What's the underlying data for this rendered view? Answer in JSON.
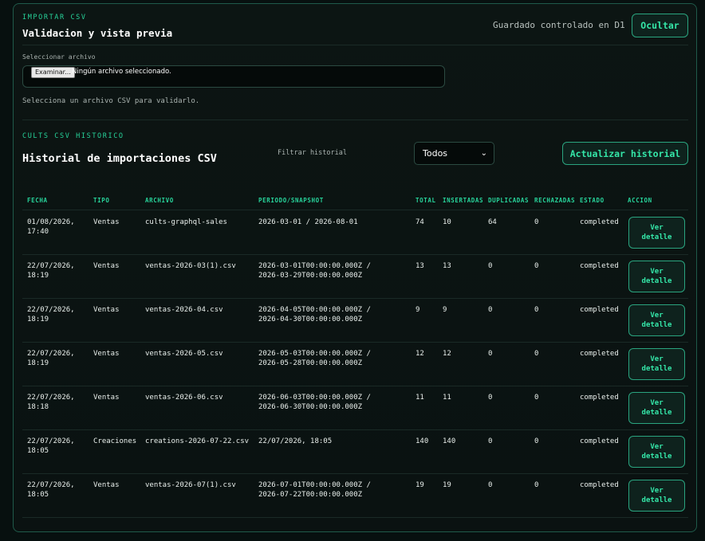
{
  "import": {
    "eyebrow": "IMPORTAR CSV",
    "title": "Validacion y vista previa",
    "saved_status": "Guardado controlado en D1",
    "hide_label": "Ocultar",
    "file_label": "Seleccionar archivo",
    "file_button": "Examinar...",
    "file_status": "Ningún archivo seleccionado.",
    "hint": "Selecciona un archivo CSV para validarlo."
  },
  "history": {
    "eyebrow": "CULTS CSV HISTORICO",
    "title": "Historial de importaciones CSV",
    "filter_label": "Filtrar historial",
    "filter_value": "Todos",
    "refresh_label": "Actualizar historial",
    "columns": [
      "FECHA",
      "TIPO",
      "ARCHIVO",
      "PERIODO/SNAPSHOT",
      "TOTAL",
      "INSERTADAS",
      "DUPLICADAS",
      "RECHAZADAS",
      "ESTADO",
      "ACCION"
    ],
    "rows": [
      {
        "fecha": "01/08/2026,\n17:40",
        "tipo": "Ventas",
        "archivo": "cults-graphql-sales",
        "periodo": "2026-03-01 / 2026-08-01",
        "total": "74",
        "insertadas": "10",
        "duplicadas": "64",
        "rechazadas": "0",
        "estado": "completed",
        "accion": "Ver\ndetalle"
      },
      {
        "fecha": "22/07/2026,\n18:19",
        "tipo": "Ventas",
        "archivo": "ventas-2026-03(1).csv",
        "periodo": "2026-03-01T00:00:00.000Z /\n2026-03-29T00:00:00.000Z",
        "total": "13",
        "insertadas": "13",
        "duplicadas": "0",
        "rechazadas": "0",
        "estado": "completed",
        "accion": "Ver\ndetalle"
      },
      {
        "fecha": "22/07/2026,\n18:19",
        "tipo": "Ventas",
        "archivo": "ventas-2026-04.csv",
        "periodo": "2026-04-05T00:00:00.000Z /\n2026-04-30T00:00:00.000Z",
        "total": "9",
        "insertadas": "9",
        "duplicadas": "0",
        "rechazadas": "0",
        "estado": "completed",
        "accion": "Ver\ndetalle"
      },
      {
        "fecha": "22/07/2026,\n18:19",
        "tipo": "Ventas",
        "archivo": "ventas-2026-05.csv",
        "periodo": "2026-05-03T00:00:00.000Z /\n2026-05-28T00:00:00.000Z",
        "total": "12",
        "insertadas": "12",
        "duplicadas": "0",
        "rechazadas": "0",
        "estado": "completed",
        "accion": "Ver\ndetalle"
      },
      {
        "fecha": "22/07/2026,\n18:18",
        "tipo": "Ventas",
        "archivo": "ventas-2026-06.csv",
        "periodo": "2026-06-03T00:00:00.000Z /\n2026-06-30T00:00:00.000Z",
        "total": "11",
        "insertadas": "11",
        "duplicadas": "0",
        "rechazadas": "0",
        "estado": "completed",
        "accion": "Ver\ndetalle"
      },
      {
        "fecha": "22/07/2026,\n18:05",
        "tipo": "Creaciones",
        "archivo": "creations-2026-07-22.csv",
        "periodo": "22/07/2026, 18:05",
        "total": "140",
        "insertadas": "140",
        "duplicadas": "0",
        "rechazadas": "0",
        "estado": "completed",
        "accion": "Ver\ndetalle"
      },
      {
        "fecha": "22/07/2026,\n18:05",
        "tipo": "Ventas",
        "archivo": "ventas-2026-07(1).csv",
        "periodo": "2026-07-01T00:00:00.000Z /\n2026-07-22T00:00:00.000Z",
        "total": "19",
        "insertadas": "19",
        "duplicadas": "0",
        "rechazadas": "0",
        "estado": "completed",
        "accion": "Ver\ndetalle"
      }
    ]
  }
}
